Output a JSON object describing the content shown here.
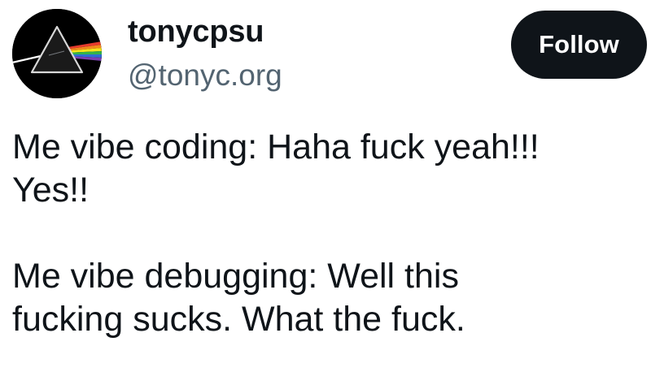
{
  "author": {
    "display_name": "tonycpsu",
    "handle": "@tonyc.org",
    "avatar_icon": "prism-rainbow-icon"
  },
  "actions": {
    "follow_label": "Follow"
  },
  "post": {
    "paragraph_1": {
      "line_1": "Me vibe coding: Haha fuck yeah!!!",
      "line_2": "Yes!!"
    },
    "paragraph_2": {
      "line_1": "Me vibe debugging: Well this",
      "line_2": "fucking sucks. What the fuck."
    }
  },
  "colors": {
    "text_primary": "#0f1419",
    "text_secondary": "#536471",
    "button_bg": "#0f1419",
    "button_text": "#ffffff"
  }
}
